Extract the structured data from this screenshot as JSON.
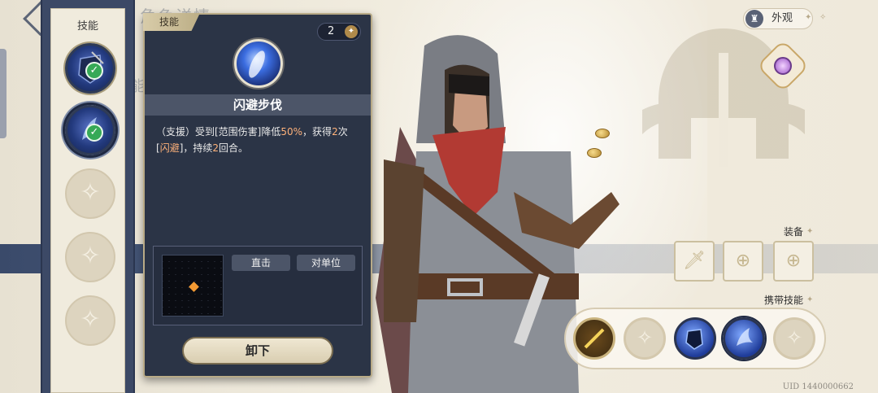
{
  "header": {
    "title_faint": "角色详情",
    "subtitle_faint": "能力概要"
  },
  "skill_column": {
    "title": "技能"
  },
  "popup": {
    "tag": "技能",
    "cost": "2",
    "skill_name": "闪避步伐",
    "desc_prefix": "（支援）受到[范围伤害]降低",
    "desc_pct": "50%",
    "desc_mid": "，获得",
    "desc_count": "2",
    "desc_mid2": "次[",
    "desc_dodge": "闪避",
    "desc_mid3": "]，持续",
    "desc_turns": "2",
    "desc_suffix": "回合。",
    "tag_direct": "直击",
    "tag_target": "对单位",
    "unequip": "卸下"
  },
  "topright": {
    "appearance": "外观"
  },
  "equipment": {
    "label": "装备"
  },
  "carry": {
    "label": "携带技能"
  },
  "footer": {
    "uid": "UID 1440000662"
  },
  "colors": {
    "accent_orange": "#ffb27a",
    "check_green": "#36a957",
    "panel_dark": "#2b3446"
  }
}
